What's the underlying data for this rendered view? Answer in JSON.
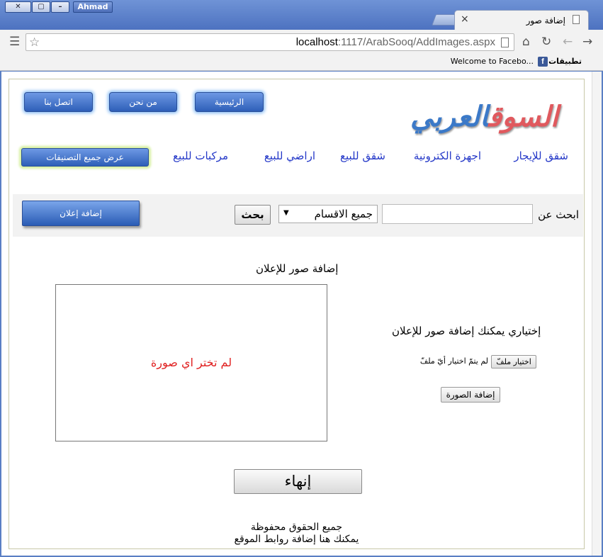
{
  "window": {
    "profile": "Ahmad",
    "tab_title": "إضافة صور",
    "tab_close": "×"
  },
  "toolbar": {
    "url_host": "localhost",
    "url_rest": ":1117/ArabSooq/AddImages.aspx"
  },
  "bookmarks": {
    "apps": "تطبيقات",
    "facebook": "Welcome to Facebo..."
  },
  "site": {
    "logo_part1": "السوق",
    "logo_part2": "العربي",
    "top_nav": {
      "home": "الرئيسية",
      "about": "من نحن",
      "contact": "اتصل بنا"
    },
    "categories": [
      "شقق للإيجار",
      "اجهزة الكترونية",
      "شقق للبيع",
      "اراضي للبيع",
      "مركبات للبيع"
    ],
    "all_categories_button": "عرض جميع التصنيفات"
  },
  "search": {
    "label": "ابحث عن",
    "value": "",
    "category_selected": "جميع الاقسام",
    "button": "بحث",
    "add_ad_button": "إضافة إعلان"
  },
  "upload": {
    "title": "إضافة صور للإعلان",
    "preview_message": "لم تختر اي صورة",
    "optional_text": "إختياري يمكنك إضافة صور للإعلان",
    "choose_file_button": "اختيار ملفّ",
    "file_status": "لم يتمّ اختيار أيّ ملفّ",
    "add_image_button": "إضافة الصورة",
    "finish_button": "إنهاء"
  },
  "footer": {
    "rights": "جميع الحقوق محفوظة",
    "links_note": "يمكنك هنا إضافة روابط الموقع"
  }
}
